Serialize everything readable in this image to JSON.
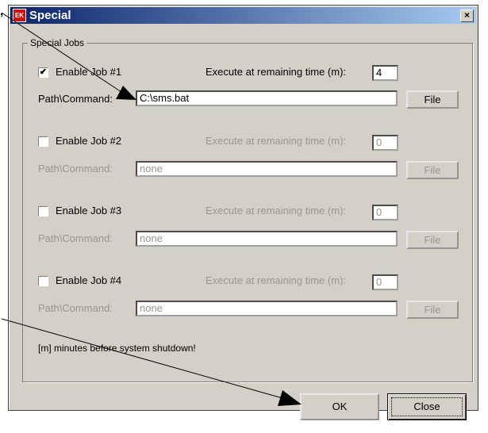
{
  "dialog": {
    "title": "Special",
    "close_glyph": "×",
    "app_icon": "app-logo-icon"
  },
  "leading_comma": ",",
  "group": {
    "legend": "Special Jobs"
  },
  "jobs": [
    {
      "enable_label": "Enable Job #1",
      "enabled": true,
      "checkmark": "✔",
      "time_label": "Execute at remaining time (m):",
      "time_value": "4",
      "path_label": "Path\\Command:",
      "path_value": "C:\\sms.bat",
      "file_label": "File"
    },
    {
      "enable_label": "Enable Job #2",
      "enabled": false,
      "checkmark": "",
      "time_label": "Execute at remaining time (m):",
      "time_value": "0",
      "path_label": "Path\\Command:",
      "path_value": "none",
      "file_label": "File"
    },
    {
      "enable_label": "Enable Job #3",
      "enabled": false,
      "checkmark": "",
      "time_label": "Execute at remaining time (m):",
      "time_value": "0",
      "path_label": "Path\\Command:",
      "path_value": "none",
      "file_label": "File"
    },
    {
      "enable_label": "Enable Job #4",
      "enabled": false,
      "checkmark": "",
      "time_label": "Execute at remaining time (m):",
      "time_value": "0",
      "path_label": "Path\\Command:",
      "path_value": "none",
      "file_label": "File"
    }
  ],
  "footer_note": "[m] minutes before system shutdown!",
  "buttons": {
    "ok": "OK",
    "close": "Close"
  },
  "colors": {
    "title_gradient_start": "#0a246a",
    "title_gradient_end": "#a6caf0",
    "face": "#d4d0c8",
    "disabled_text": "#9a968e"
  }
}
